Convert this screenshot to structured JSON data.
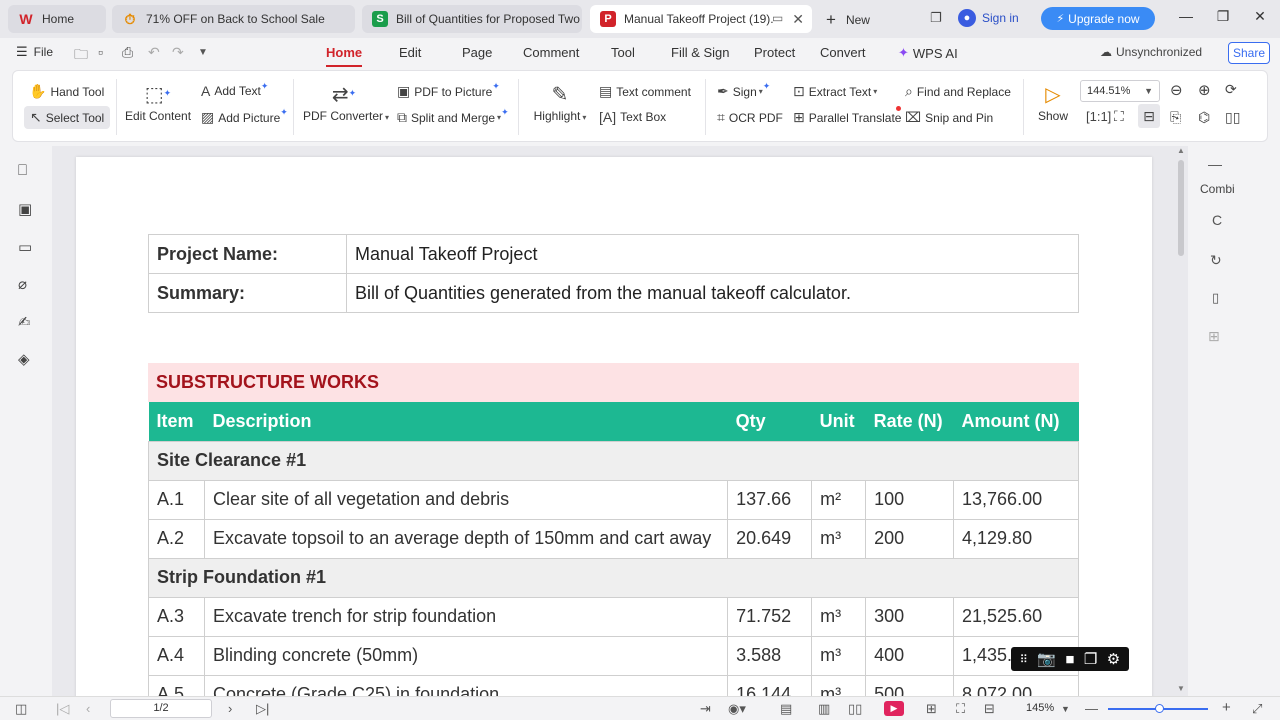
{
  "tabs": [
    {
      "label": "Home",
      "icon": "wps-logo-icon"
    },
    {
      "label": "71% OFF on Back to School Sale",
      "icon": "timer-icon"
    },
    {
      "label": "Bill of Quantities for Proposed Two Be",
      "icon": "sheet-icon"
    },
    {
      "label": "Manual Takeoff Project (19).p",
      "icon": "pdf-icon"
    }
  ],
  "new_tab_label": "New",
  "sign_in_label": "Sign in",
  "upgrade_label": "Upgrade now",
  "menu": {
    "file": "File",
    "items": [
      "Home",
      "Edit",
      "Page",
      "Comment",
      "Tool",
      "Fill & Sign",
      "Protect",
      "Convert",
      "WPS AI"
    ],
    "active": "Home",
    "sync_status": "Unsynchronized",
    "share": "Share"
  },
  "ribbon": {
    "hand_tool": "Hand Tool",
    "select_tool": "Select Tool",
    "edit_content": "Edit Content",
    "add_text": "Add Text",
    "add_picture": "Add Picture",
    "pdf_converter": "PDF Converter",
    "pdf_to_picture": "PDF to Picture",
    "split_merge": "Split and Merge",
    "highlight": "Highlight",
    "text_comment": "Text comment",
    "text_box": "Text Box",
    "sign": "Sign",
    "ocr_pdf": "OCR PDF",
    "extract_text": "Extract Text",
    "parallel_translate": "Parallel Translate",
    "find_replace": "Find and Replace",
    "snip_pin": "Snip and Pin",
    "show": "Show",
    "zoom": "144.51%"
  },
  "document": {
    "project_name_label": "Project Name:",
    "project_name_value": "Manual Takeoff Project",
    "summary_label": "Summary:",
    "summary_value": "Bill of Quantities generated from the manual takeoff calculator.",
    "section_title": "SUBSTRUCTURE WORKS",
    "columns": [
      "Item",
      "Description",
      "Qty",
      "Unit",
      "Rate (N)",
      "Amount (N)"
    ],
    "groups": [
      {
        "title": "Site Clearance #1",
        "rows": [
          [
            "A.1",
            "Clear site of all vegetation and debris",
            "137.66",
            "m²",
            "100",
            "13,766.00"
          ],
          [
            "A.2",
            "Excavate topsoil to an average depth of 150mm and cart away",
            "20.649",
            "m³",
            "200",
            "4,129.80"
          ]
        ]
      },
      {
        "title": "Strip Foundation #1",
        "rows": [
          [
            "A.3",
            "Excavate trench for strip foundation",
            "71.752",
            "m³",
            "300",
            "21,525.60"
          ],
          [
            "A.4",
            "Blinding concrete (50mm)",
            "3.588",
            "m³",
            "400",
            "1,435.20"
          ],
          [
            "A.5",
            "Concrete (Grade C25) in foundation",
            "16.144",
            "m³",
            "500",
            "8,072.00"
          ]
        ]
      }
    ]
  },
  "right_panel": {
    "label": "Combi"
  },
  "status": {
    "page": "1/2",
    "zoom": "145%"
  },
  "colors": {
    "accent_red": "#d1232a",
    "table_header": "#1db892",
    "section_bg": "#fde2e4",
    "section_text": "#a3131c",
    "upgrade": "#3a8bf5"
  }
}
